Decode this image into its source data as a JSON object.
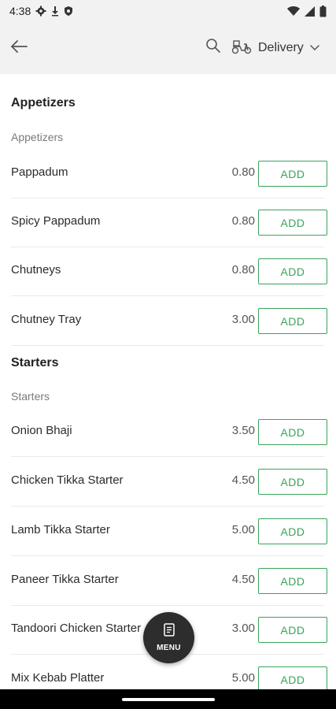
{
  "status": {
    "time": "4:38",
    "left_icons": [
      "gear-icon",
      "download-icon",
      "shield-icon"
    ],
    "right_icons": [
      "wifi-icon",
      "signal-icon",
      "battery-icon"
    ]
  },
  "app_bar": {
    "back_icon": "arrow-left-icon",
    "search_icon": "search-icon",
    "delivery_icon": "scooter-icon",
    "delivery_label": "Delivery",
    "dropdown_icon": "chevron-down-icon"
  },
  "sections": [
    {
      "title": "Appetizers",
      "subtitle": "Appetizers",
      "items": [
        {
          "name": "Pappadum",
          "price": "0.80",
          "button": "ADD"
        },
        {
          "name": "Spicy Pappadum",
          "price": "0.80",
          "button": "ADD"
        },
        {
          "name": "Chutneys",
          "price": "0.80",
          "button": "ADD"
        },
        {
          "name": "Chutney Tray",
          "price": "3.00",
          "button": "ADD"
        }
      ]
    },
    {
      "title": "Starters",
      "subtitle": "Starters",
      "items": [
        {
          "name": "Onion Bhaji",
          "price": "3.50",
          "button": "ADD"
        },
        {
          "name": "Chicken Tikka Starter",
          "price": "4.50",
          "button": "ADD"
        },
        {
          "name": "Lamb Tikka Starter",
          "price": "5.00",
          "button": "ADD"
        },
        {
          "name": "Paneer Tikka Starter",
          "price": "4.50",
          "button": "ADD"
        },
        {
          "name": "Tandoori Chicken Starter",
          "price": "3.00",
          "button": "ADD"
        },
        {
          "name": "Mix Kebab Platter",
          "price": "5.00",
          "button": "ADD"
        }
      ]
    }
  ],
  "fab": {
    "icon": "menu-document-icon",
    "label": "MENU"
  },
  "colors": {
    "accent_green": "#3aa35a",
    "app_bar_bg": "#f2f2f2",
    "fab_bg": "#2d2d2d"
  }
}
